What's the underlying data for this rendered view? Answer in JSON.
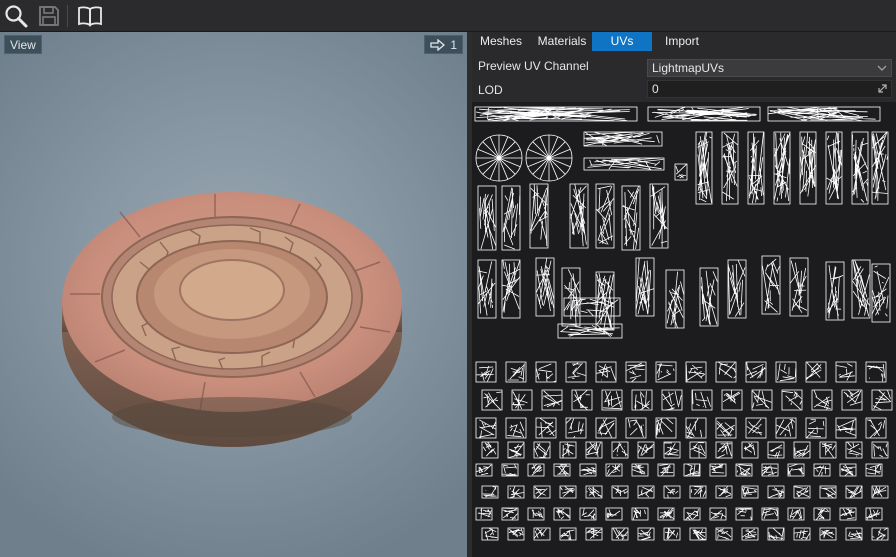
{
  "toolbar": {
    "buttons": [
      {
        "name": "search-icon"
      },
      {
        "name": "save-icon"
      },
      {
        "name": "open-book-icon"
      }
    ]
  },
  "viewport": {
    "view_label": "View",
    "camera_speed": "1"
  },
  "tabs": [
    {
      "label": "Meshes",
      "active": false
    },
    {
      "label": "Materials",
      "active": false
    },
    {
      "label": "UVs",
      "active": true
    },
    {
      "label": "Import",
      "active": false
    }
  ],
  "properties": {
    "preview_uv_channel_label": "Preview UV Channel",
    "preview_uv_channel_value": "LightmapUVs",
    "lod_label": "LOD",
    "lod_value": "0"
  },
  "colors": {
    "accent": "#0f74c4",
    "panel_bg": "#2a2a2c",
    "uv_lines": "#ffffff",
    "stone": "#c98d7e"
  }
}
